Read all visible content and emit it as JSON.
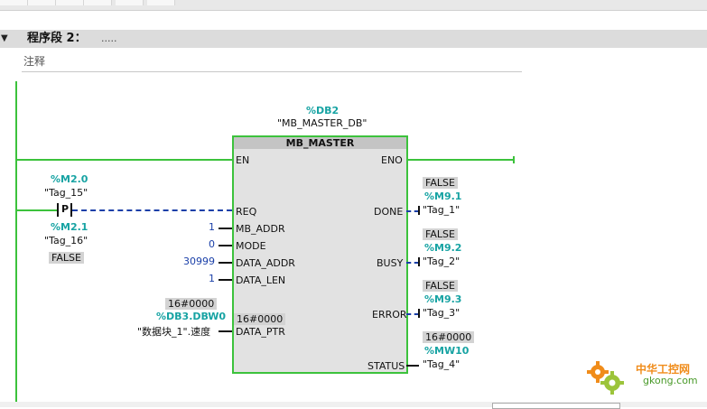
{
  "segment": {
    "title": "程序段 2：",
    "dots": ".....",
    "comment": "注释"
  },
  "block": {
    "instance_addr": "%DB2",
    "instance_name": "\"MB_MASTER_DB\"",
    "title": "MB_MASTER",
    "inputs": [
      "EN",
      "REQ",
      "MB_ADDR",
      "MODE",
      "DATA_ADDR",
      "DATA_LEN",
      "DATA_PTR"
    ],
    "outputs": [
      "ENO",
      "DONE",
      "BUSY",
      "ERROR",
      "STATUS"
    ]
  },
  "req_contacts": {
    "c1_addr": "%M2.0",
    "c1_tag": "\"Tag_15\"",
    "p_label": "P",
    "c2_addr": "%M2.1",
    "c2_tag": "\"Tag_16\"",
    "c2_value": "FALSE"
  },
  "params": {
    "mb_addr": "1",
    "mode": "0",
    "data_addr": "30999",
    "data_len": "1",
    "data_ptr_value": "16#0000",
    "data_ptr_addr": "%DB3.DBW0",
    "data_ptr_name": "\"数据块_1\".速度",
    "data_ptr_inner": "16#0000"
  },
  "outputs": {
    "done_value": "FALSE",
    "done_addr": "%M9.1",
    "done_tag": "\"Tag_1\"",
    "busy_value": "FALSE",
    "busy_addr": "%M9.2",
    "busy_tag": "\"Tag_2\"",
    "error_value": "FALSE",
    "error_addr": "%M9.3",
    "error_tag": "\"Tag_3\"",
    "status_value": "16#0000",
    "status_addr": "%MW10",
    "status_tag": "\"Tag_4\""
  },
  "watermark": {
    "cn": "中华工控网",
    "en": "gkong.com"
  },
  "colors": {
    "green": "#3cc23c",
    "teal": "#17a3a3",
    "blue": "#1a3fa8",
    "orange": "#f08c1a"
  }
}
